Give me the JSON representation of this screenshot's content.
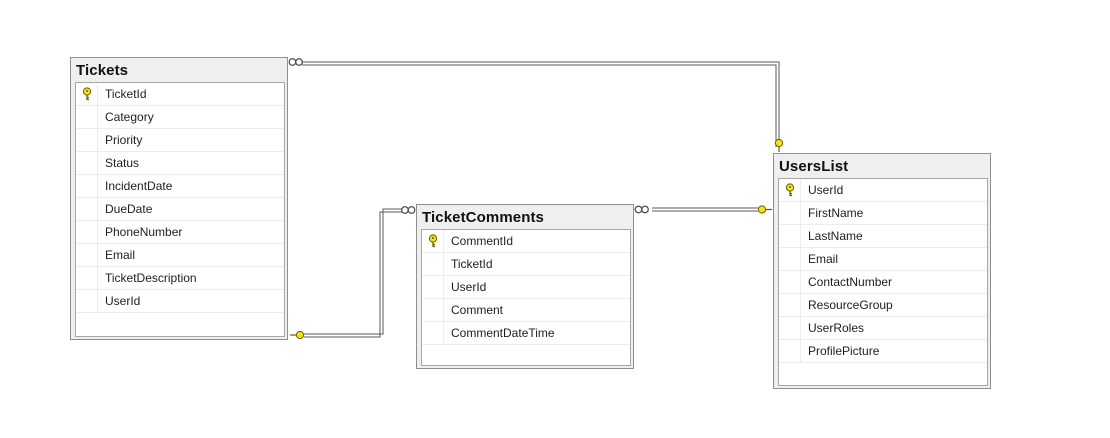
{
  "colors": {
    "canvas": "#ffffff",
    "table_frame": "#efefef",
    "grid_border": "#a7a7a7",
    "connector": "#5a5a5a",
    "key_fill": "#f2e21a",
    "key_stroke": "#6b5d00"
  },
  "tables": {
    "tickets": {
      "title": "Tickets",
      "columns": [
        {
          "name": "TicketId",
          "primary_key": true
        },
        {
          "name": "Category",
          "primary_key": false
        },
        {
          "name": "Priority",
          "primary_key": false
        },
        {
          "name": "Status",
          "primary_key": false
        },
        {
          "name": "IncidentDate",
          "primary_key": false
        },
        {
          "name": "DueDate",
          "primary_key": false
        },
        {
          "name": "PhoneNumber",
          "primary_key": false
        },
        {
          "name": "Email",
          "primary_key": false
        },
        {
          "name": "TicketDescription",
          "primary_key": false
        },
        {
          "name": "UserId",
          "primary_key": false
        }
      ]
    },
    "ticket_comments": {
      "title": "TicketComments",
      "columns": [
        {
          "name": "CommentId",
          "primary_key": true
        },
        {
          "name": "TicketId",
          "primary_key": false
        },
        {
          "name": "UserId",
          "primary_key": false
        },
        {
          "name": "Comment",
          "primary_key": false
        },
        {
          "name": "CommentDateTime",
          "primary_key": false
        }
      ]
    },
    "users_list": {
      "title": "UsersList",
      "columns": [
        {
          "name": "UserId",
          "primary_key": true
        },
        {
          "name": "FirstName",
          "primary_key": false
        },
        {
          "name": "LastName",
          "primary_key": false
        },
        {
          "name": "Email",
          "primary_key": false
        },
        {
          "name": "ContactNumber",
          "primary_key": false
        },
        {
          "name": "ResourceGroup",
          "primary_key": false
        },
        {
          "name": "UserRoles",
          "primary_key": false
        },
        {
          "name": "ProfilePicture",
          "primary_key": false
        }
      ]
    }
  },
  "relationships": [
    {
      "one": "users_list",
      "many": "tickets",
      "one_end_icon": "key-icon",
      "many_end_icon": "infinity-icon"
    },
    {
      "one": "tickets",
      "many": "ticket_comments",
      "one_end_icon": "key-icon",
      "many_end_icon": "infinity-icon"
    },
    {
      "one": "users_list",
      "many": "ticket_comments",
      "one_end_icon": "key-icon",
      "many_end_icon": "infinity-icon"
    }
  ]
}
